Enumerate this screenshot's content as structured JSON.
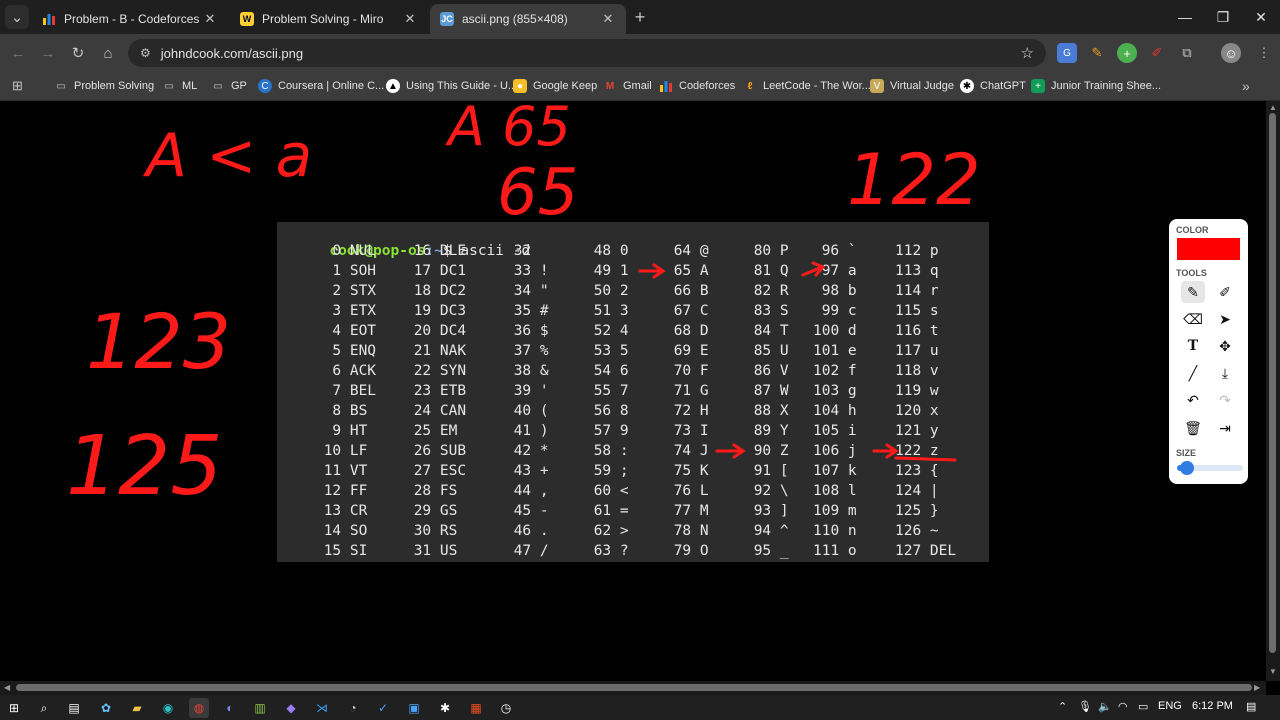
{
  "tabs": [
    {
      "title": "Problem - B - Codeforces",
      "icon": "codeforces-icon"
    },
    {
      "title": "Problem Solving - Miro",
      "icon": "miro-icon"
    },
    {
      "title": "ascii.png (855×408)",
      "icon": "image-icon"
    }
  ],
  "new_tab_symbol": "+",
  "address": {
    "url": "johndcook.com/ascii.png"
  },
  "bookmarks": [
    {
      "label": "Problem Solving",
      "icon": "folder-icon"
    },
    {
      "label": "ML",
      "icon": "folder-icon"
    },
    {
      "label": "GP",
      "icon": "folder-icon"
    },
    {
      "label": "Coursera | Online C...",
      "icon": "coursera-icon"
    },
    {
      "label": "Using This Guide - U...",
      "icon": "guide-icon"
    },
    {
      "label": "Google Keep",
      "icon": "keep-icon"
    },
    {
      "label": "Gmail",
      "icon": "gmail-icon"
    },
    {
      "label": "Codeforces",
      "icon": "codeforces-icon"
    },
    {
      "label": "LeetCode - The Wor...",
      "icon": "leetcode-icon"
    },
    {
      "label": "Virtual Judge",
      "icon": "vjudge-icon"
    },
    {
      "label": "ChatGPT",
      "icon": "chatgpt-icon"
    },
    {
      "label": "Junior Training Shee...",
      "icon": "sheets-icon"
    }
  ],
  "terminal": {
    "prompt_user": "cook@pop-os",
    "prompt_path": ":~",
    "prompt_symbol": "$",
    "command": "ascii -d",
    "columns": [
      [
        "0 NUL",
        "1 SOH",
        "2 STX",
        "3 ETX",
        "4 EOT",
        "5 ENQ",
        "6 ACK",
        "7 BEL",
        "8 BS",
        "9 HT",
        "10 LF",
        "11 VT",
        "12 FF",
        "13 CR",
        "14 SO",
        "15 SI"
      ],
      [
        "16 DLE",
        "17 DC1",
        "18 DC2",
        "19 DC3",
        "20 DC4",
        "21 NAK",
        "22 SYN",
        "23 ETB",
        "24 CAN",
        "25 EM",
        "26 SUB",
        "27 ESC",
        "28 FS",
        "29 GS",
        "30 RS",
        "31 US"
      ],
      [
        "32",
        "33 !",
        "34 \"",
        "35 #",
        "36 $",
        "37 %",
        "38 &",
        "39 '",
        "40 (",
        "41 )",
        "42 *",
        "43 +",
        "44 ,",
        "45 -",
        "46 .",
        "47 /"
      ],
      [
        "48 0",
        "49 1",
        "50 2",
        "51 3",
        "52 4",
        "53 5",
        "54 6",
        "55 7",
        "56 8",
        "57 9",
        "58 :",
        "59 ;",
        "60 <",
        "61 =",
        "62 >",
        "63 ?"
      ],
      [
        "64 @",
        "65 A",
        "66 B",
        "67 C",
        "68 D",
        "69 E",
        "70 F",
        "71 G",
        "72 H",
        "73 I",
        "74 J",
        "75 K",
        "76 L",
        "77 M",
        "78 N",
        "79 O"
      ],
      [
        "80 P",
        "81 Q",
        "82 R",
        "83 S",
        "84 T",
        "85 U",
        "86 V",
        "87 W",
        "88 X",
        "89 Y",
        "90 Z",
        "91 [",
        "92 \\",
        "93 ]",
        "94 ^",
        "95 _"
      ],
      [
        "96 `",
        "97 a",
        "98 b",
        "99 c",
        "100 d",
        "101 e",
        "102 f",
        "103 g",
        "104 h",
        "105 i",
        "106 j",
        "107 k",
        "108 l",
        "109 m",
        "110 n",
        "111 o"
      ],
      [
        "112 p",
        "113 q",
        "114 r",
        "115 s",
        "116 t",
        "117 u",
        "118 v",
        "119 w",
        "120 x",
        "121 y",
        "122 z",
        "123 {",
        "124 |",
        "125 }",
        "126 ~",
        "127 DEL"
      ]
    ]
  },
  "annotations": {
    "a_less_a": "A < a",
    "a_65": "A 65",
    "n_65": "65",
    "n_122": "122",
    "n_123": "123",
    "n_125": "125",
    "ink_color": "#ff1a1a"
  },
  "miro_panel": {
    "color_label": "COLOR",
    "selected_color": "#ff0000",
    "tools_label": "TOOLS",
    "size_label": "SIZE",
    "size_value": 0.05
  },
  "taskbar": {
    "language": "ENG",
    "time": "6:12 PM"
  }
}
